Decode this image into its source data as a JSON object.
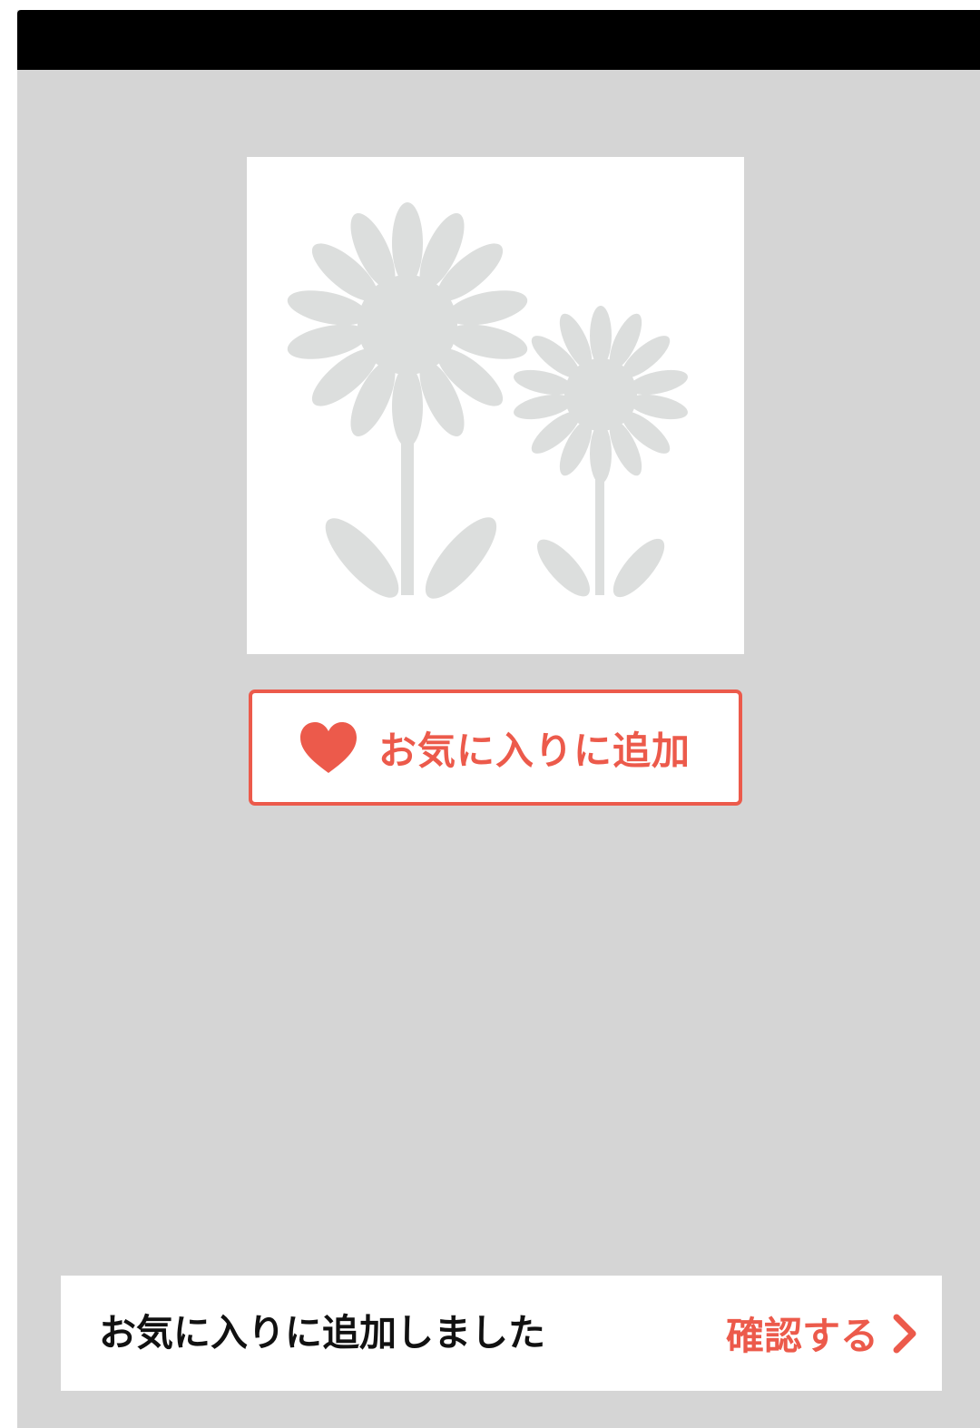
{
  "favorite_button": {
    "label": "お気に入りに追加",
    "icon": "heart-icon"
  },
  "product_image": {
    "icon": "flowers-placeholder-icon"
  },
  "toast": {
    "message": "お気に入りに追加しました",
    "action_label": "確認する",
    "action_icon": "chevron-right-icon"
  },
  "colors": {
    "accent": "#ec5a4b",
    "background": "#d5d5d5",
    "top_bar": "#000000",
    "placeholder_art": "#dcdedd"
  }
}
